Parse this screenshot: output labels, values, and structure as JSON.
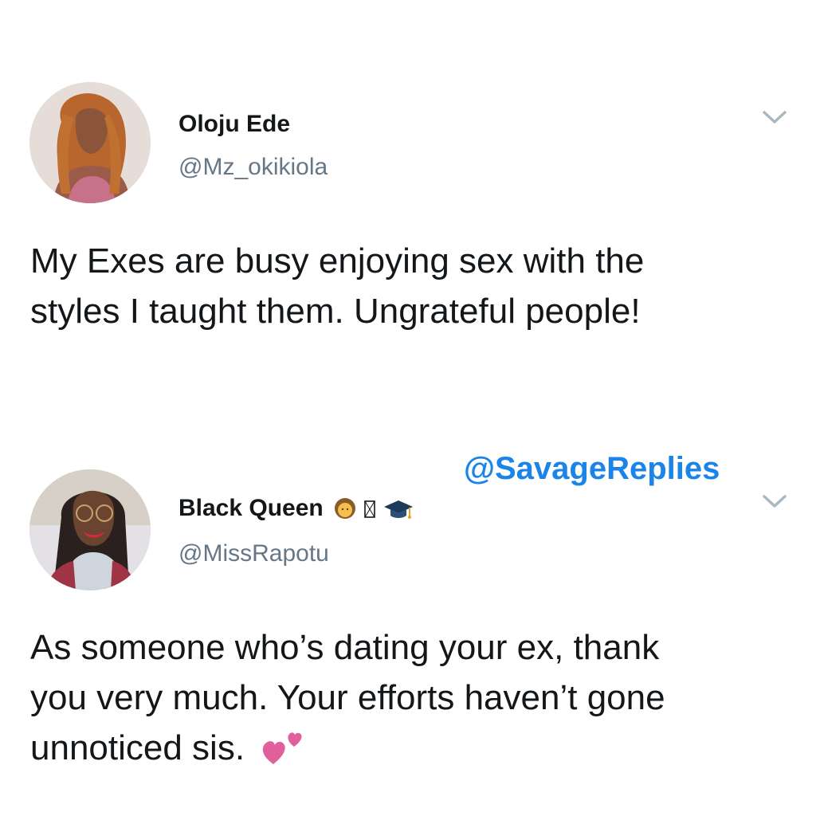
{
  "tweets": [
    {
      "display_name": "Oloju Ede",
      "handle": "@Mz_okikiola",
      "text_lines": [
        "My Exes are busy enjoying sex with the",
        "styles I taught them. Ungrateful people!"
      ],
      "avatar": "avatar-woman-curly-hair",
      "menu_icon": "chevron-down-icon"
    },
    {
      "display_name": "Black Queen",
      "name_emojis": [
        "woman-emoji",
        "box-glyph",
        "graduation-cap-emoji"
      ],
      "handle": "@MissRapotu",
      "text_lines": [
        "As someone who’s dating your ex, thank",
        "you very much. Your efforts haven’t gone",
        "unnoticed sis."
      ],
      "trailing_emoji": "two-hearts-emoji",
      "avatar": "avatar-woman-glasses-braids",
      "menu_icon": "chevron-down-icon"
    }
  ],
  "watermark": "@SavageReplies",
  "colors": {
    "text": "#14171a",
    "handle": "#657786",
    "watermark": "#1b84e8",
    "caret": "#aab8c2",
    "hearts": "#e0609c"
  }
}
